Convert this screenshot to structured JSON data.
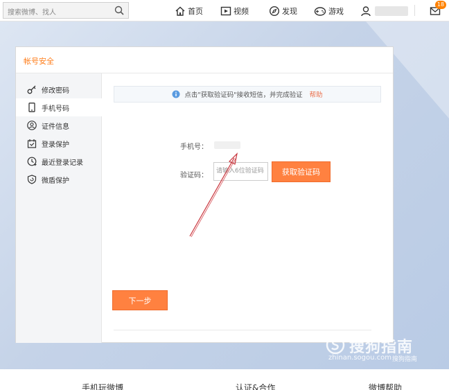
{
  "topbar": {
    "search_placeholder": "搜索微博、找人",
    "nav": [
      {
        "label": "首页",
        "icon": "home-icon"
      },
      {
        "label": "视频",
        "icon": "video-icon"
      },
      {
        "label": "发现",
        "icon": "compass-icon"
      },
      {
        "label": "游戏",
        "icon": "gamepad-icon"
      }
    ],
    "user_icon": "user-icon",
    "message_icon": "mail-icon",
    "message_badge": "18"
  },
  "dialog": {
    "title": "帐号安全",
    "sidebar": [
      {
        "label": "修改密码",
        "icon": "key-icon",
        "active": false
      },
      {
        "label": "手机号码",
        "icon": "phone-icon",
        "active": true
      },
      {
        "label": "证件信息",
        "icon": "id-card-icon",
        "active": false
      },
      {
        "label": "登录保护",
        "icon": "login-protect-icon",
        "active": false
      },
      {
        "label": "最近登录记录",
        "icon": "recent-login-icon",
        "active": false
      },
      {
        "label": "微盾保护",
        "icon": "shield-icon",
        "active": false
      }
    ],
    "notice": {
      "text": "点击\"获取验证码\"接收短信，并完成验证",
      "help": "帮助"
    },
    "phone_label": "手机号：",
    "code_label": "验证码：",
    "code_placeholder": "请输入6位验证码",
    "get_code_button": "获取验证码",
    "next_button": "下一步"
  },
  "footer": {
    "links": [
      "手机玩微博",
      "认证&合作",
      "微博帮助"
    ]
  },
  "watermark": {
    "main": "搜狗指南",
    "url": "zhinan.sogou.com",
    "sub": "搜狗指南"
  },
  "colors": {
    "accent": "#ff8140",
    "title": "#ff7d1a",
    "help_link": "#eb7350",
    "arrow": "#c8323a"
  }
}
